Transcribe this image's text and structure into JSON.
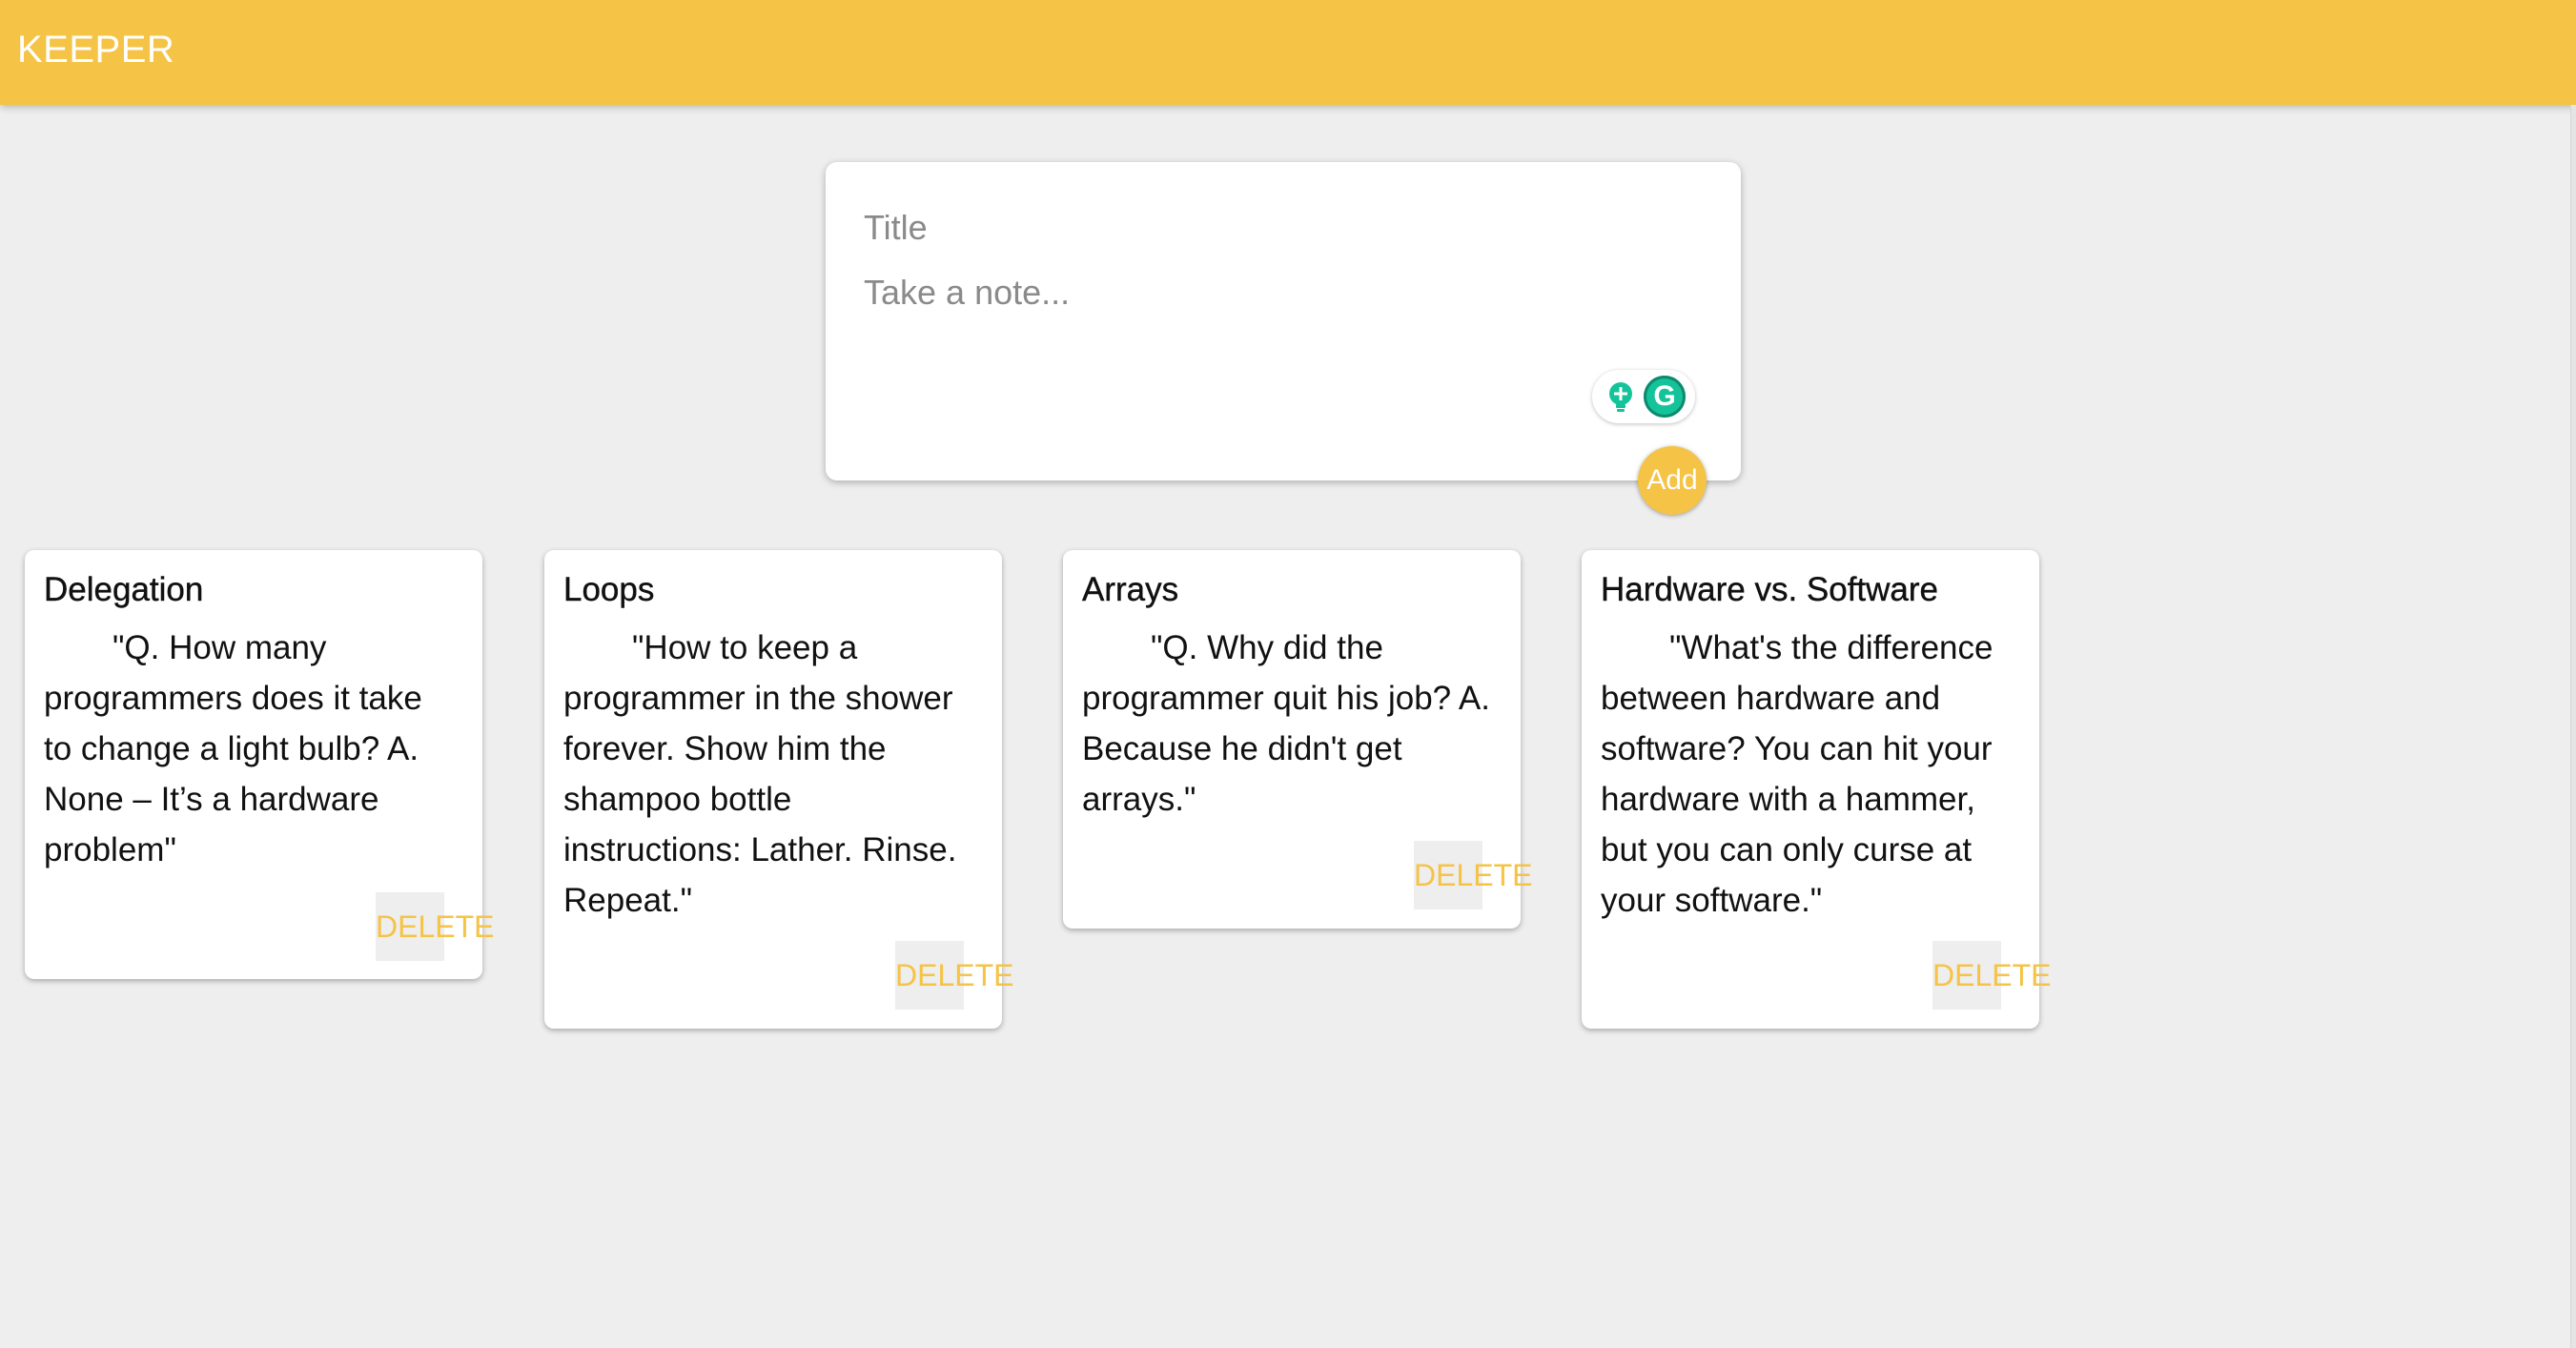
{
  "header": {
    "app_title": "KEEPER"
  },
  "create_area": {
    "title_placeholder": "Title",
    "content_placeholder": "Take a note...",
    "add_label": "Add",
    "extension_icons": [
      "lightbulb-plus-icon",
      "grammarly-g-icon"
    ]
  },
  "notes": [
    {
      "title": "Delegation",
      "content": "\"Q. How many programmers does it take to change a light bulb? A. None – It’s a hardware problem\"",
      "delete_label": "DELETE"
    },
    {
      "title": "Loops",
      "content": "\"How to keep a programmer in the shower forever. Show him the shampoo bottle instructions: Lather. Rinse. Repeat.\"",
      "delete_label": "DELETE"
    },
    {
      "title": "Arrays",
      "content": "\"Q. Why did the programmer quit his job? A. Because he didn't get arrays.\"",
      "delete_label": "DELETE"
    },
    {
      "title": "Hardware vs. Software",
      "content": "\"What's the difference between hardware and software? You can hit your hardware with a hammer, but you can only curse at your software.\"",
      "delete_label": "DELETE"
    }
  ],
  "colors": {
    "accent": "#f5c345",
    "background": "#eeeeee",
    "card": "#ffffff",
    "text": "#111111"
  }
}
